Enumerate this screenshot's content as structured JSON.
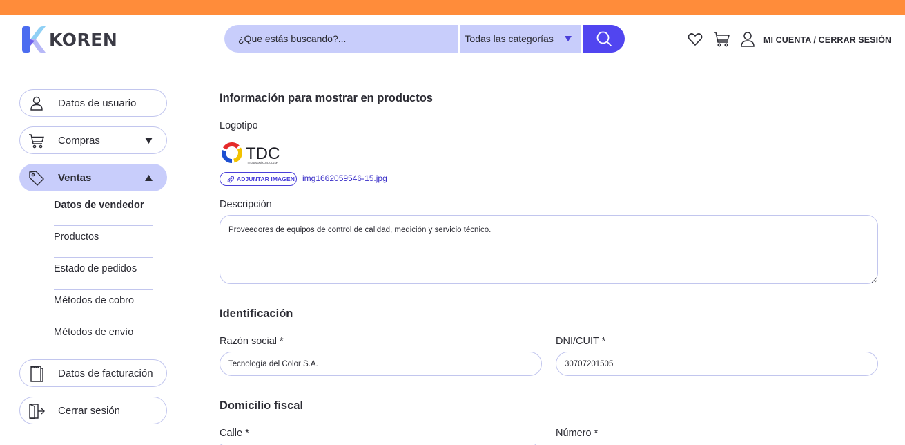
{
  "header": {
    "brand": "KOREN",
    "search": {
      "placeholder": "¿Que estás buscando?...",
      "category": "Todas las categorías"
    },
    "account_link": "MI CUENTA / CERRAR SESIÓN",
    "icons": [
      "heart-icon",
      "cart-icon",
      "user-icon"
    ]
  },
  "sidebar": {
    "items": [
      {
        "label": "Datos de usuario",
        "icon": "user-icon"
      },
      {
        "label": "Compras",
        "icon": "cart-icon"
      },
      {
        "label": "Ventas",
        "icon": "tag-icon"
      },
      {
        "label": "Datos de facturación",
        "icon": "receipt-icon"
      },
      {
        "label": "Cerrar sesión",
        "icon": "logout-icon"
      }
    ],
    "ventas_subitems": [
      "Datos de vendedor",
      "Productos",
      "Estado de pedidos",
      "Métodos de cobro",
      "Métodos de envío"
    ]
  },
  "main": {
    "section_product_info": "Información para mostrar en productos",
    "logo_label": "Logotipo",
    "logo_text": "TDC",
    "logo_subtext": "TECNOLOGÍA DEL COLOR",
    "attach_button": "ADJUNTAR IMAGEN",
    "file_name": "img1662059546-15.jpg",
    "description_label": "Descripción",
    "description_value": "Proveedores de equipos de control de calidad, medición y servicio técnico.",
    "section_identification": "Identificación",
    "razon_social_label": "Razón social *",
    "razon_social_value": "Tecnología del Color S.A.",
    "dni_label": "DNI/CUIT *",
    "dni_value": "30707201505",
    "section_domicilio": "Domicilio fiscal",
    "calle_label": "Calle *",
    "numero_label": "Número *"
  },
  "colors": {
    "top_bar": "#ff8c3a",
    "accent": "#5145f0",
    "accent_light": "#c8cdfb",
    "border": "#c2c6ee"
  }
}
